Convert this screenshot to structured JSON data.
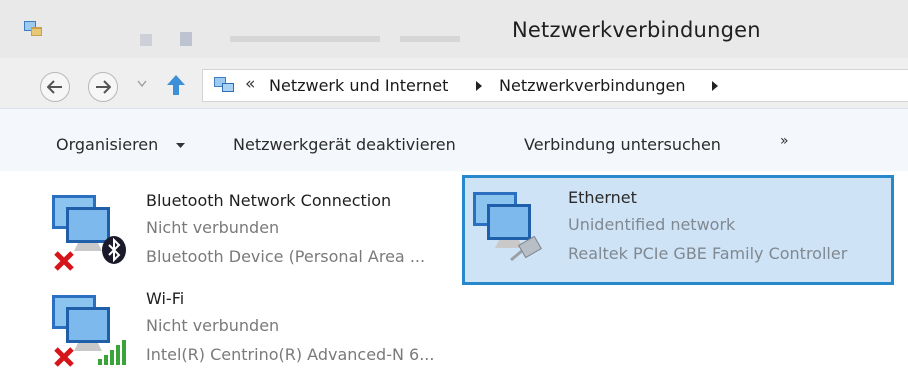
{
  "window": {
    "title": "Netzwerkverbindungen"
  },
  "address": {
    "prefix": "«",
    "crumbs": [
      "Netzwerk und Internet",
      "Netzwerkverbindungen"
    ]
  },
  "commandbar": {
    "organize": "Organisieren",
    "disable": "Netzwerkgerät deaktivieren",
    "diagnose": "Verbindung untersuchen",
    "more": "»"
  },
  "connections": [
    {
      "name": "Bluetooth Network Connection",
      "status": "Nicht verbunden",
      "device": "Bluetooth Device (Personal Area ...",
      "overlay_icon": "bluetooth-icon",
      "state_icon": "red-x-icon",
      "selected": false
    },
    {
      "name": "Ethernet",
      "status": "Unidentified network",
      "device": "Realtek PCIe GBE Family Controller",
      "overlay_icon": "ethernet-cable-icon",
      "selected": true
    },
    {
      "name": "Wi-Fi",
      "status": "Nicht verbunden",
      "device": "Intel(R) Centrino(R) Advanced-N 6...",
      "overlay_icon": "signal-bars-icon",
      "state_icon": "red-x-icon",
      "selected": false
    }
  ],
  "colors": {
    "selection_fill": "#cfe3f6",
    "selection_border": "#2788cc",
    "error_red": "#d6151b",
    "signal_green": "#3aa43a"
  }
}
